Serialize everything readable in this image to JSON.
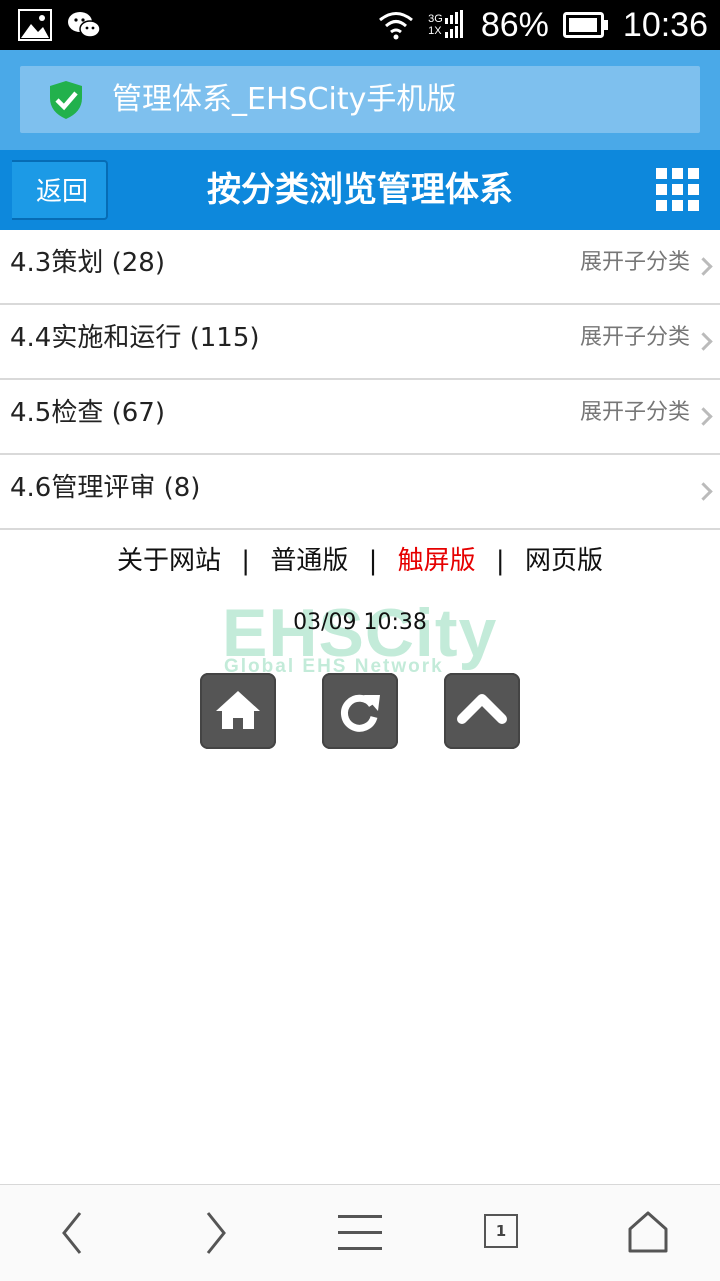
{
  "status_bar": {
    "battery_percent": "86%",
    "time": "10:36",
    "network_top": "3G",
    "network_bottom": "1X",
    "left_icons": [
      "gallery-icon",
      "wechat-icon"
    ],
    "right_icons": [
      "wifi-icon",
      "signal-icon",
      "battery-icon"
    ]
  },
  "browser": {
    "page_title": "管理体系_EHSCity手机版",
    "secure_icon": "shield-check-icon",
    "secure_color": "#22b14c"
  },
  "header": {
    "back_label": "返回",
    "title": "按分类浏览管理体系",
    "menu_icon": "grid-menu-icon",
    "bar_color": "#0d88dc"
  },
  "categories": [
    {
      "label": "4.3策划 (28)",
      "action": "展开子分类"
    },
    {
      "label": "4.4实施和运行 (115)",
      "action": "展开子分类"
    },
    {
      "label": "4.5检查 (67)",
      "action": "展开子分类"
    },
    {
      "label": "4.6管理评审 (8)",
      "action": ""
    }
  ],
  "footer": {
    "links": [
      "关于网站",
      "普通版",
      "触屏版",
      "网页版"
    ],
    "separator": "|",
    "active_link": "触屏版",
    "active_color": "#e60000",
    "logo_text": "EHSCity",
    "logo_tagline": "Global EHS Network",
    "timestamp": "03/09 10:38",
    "buttons": [
      "home-icon",
      "refresh-icon",
      "scroll-top-icon"
    ]
  },
  "bottom_nav": {
    "tab_count": "1",
    "icons": [
      "back-arrow-icon",
      "forward-arrow-icon",
      "menu-icon",
      "tabs-icon",
      "home-icon"
    ]
  }
}
